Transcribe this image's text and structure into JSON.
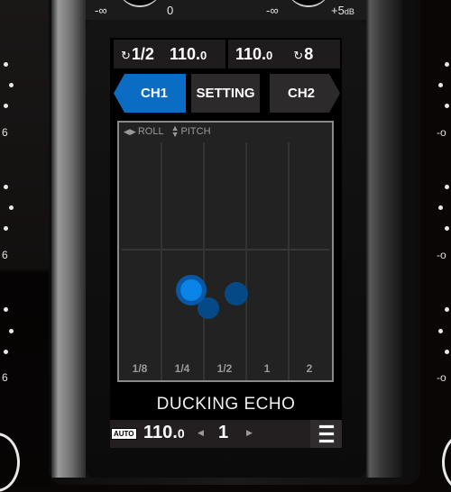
{
  "top_knobs": {
    "left": {
      "min_label": "-∞",
      "max_label": "0"
    },
    "right": {
      "min_label": "-∞",
      "max_label": "+5",
      "unit": "dB"
    }
  },
  "side_labels": {
    "left": [
      "6",
      "6",
      "6"
    ],
    "right": [
      "-o",
      "-o",
      "-o"
    ]
  },
  "bpm_bar": {
    "left": {
      "loop_icon": "loop-icon",
      "beat": "1/2",
      "bpm_int": "110.",
      "bpm_dec": "0"
    },
    "right": {
      "bpm_int": "110.",
      "bpm_dec": "0",
      "loop_icon": "loop-icon",
      "beat": "8"
    }
  },
  "tabs": [
    {
      "id": "ch1",
      "label": "CH1",
      "active": true
    },
    {
      "id": "setting",
      "label": "SETTING",
      "active": false
    },
    {
      "id": "ch2",
      "label": "CH2",
      "active": false
    }
  ],
  "xy_pad": {
    "x_axis_label": "ROLL",
    "y_axis_label": "PITCH",
    "beat_labels": [
      "1/8",
      "1/4",
      "1/2",
      "1",
      "2"
    ],
    "selected_color": "#0a84e6",
    "trail_color": "#054a86"
  },
  "effect": {
    "name": "DUCKING ECHO",
    "auto_label": "AUTO",
    "bpm_int": "110.",
    "bpm_dec": "0",
    "beat_value": "1",
    "prev_arrow": "◀",
    "next_arrow": "▶",
    "menu_icon": "menu-icon"
  },
  "colors": {
    "accent": "#0a6cc2",
    "tab_inactive": "#2d2a2b",
    "pad_bg": "#222222"
  }
}
